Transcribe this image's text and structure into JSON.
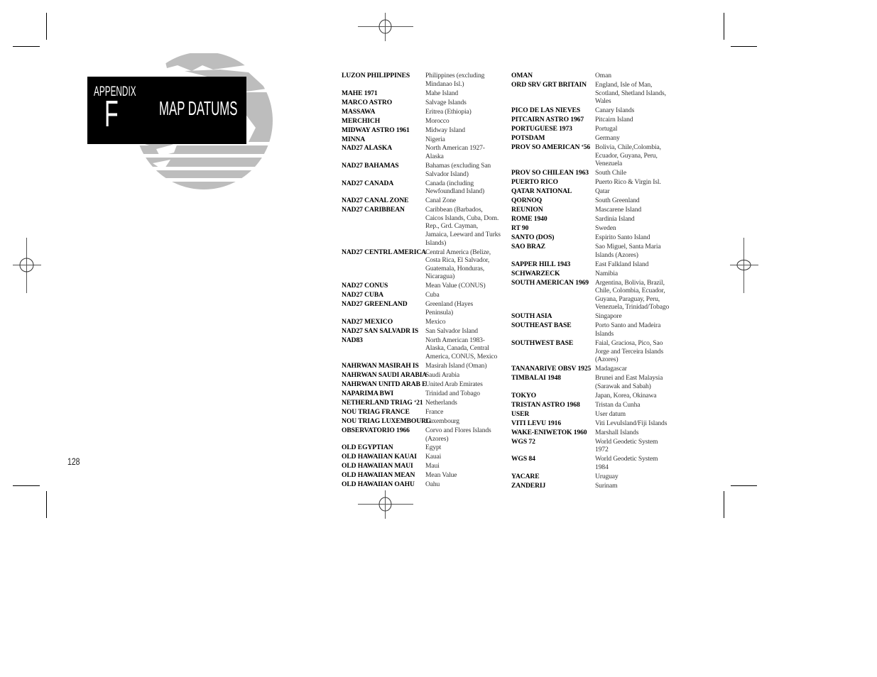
{
  "header": {
    "appendix_label": "APPENDIX",
    "appendix_letter": "F",
    "title": "MAP DATUMS",
    "globe_icon": "globe-icon"
  },
  "page_number": "128",
  "colors": {
    "header_bg": "#000000",
    "header_text": "#ffffff",
    "globe_gray": "#bdbdbd",
    "body_text": "#000000"
  },
  "datums_left": [
    {
      "name": "LUZON PHILIPPINES",
      "region": "Philippines (excluding Mindanao Isl.)"
    },
    {
      "name": "MAHE 1971",
      "region": "Mahe Island"
    },
    {
      "name": "MARCO ASTRO",
      "region": "Salvage Islands"
    },
    {
      "name": "MASSAWA",
      "region": "Eritrea (Ethiopia)"
    },
    {
      "name": "MERCHICH",
      "region": "Morocco"
    },
    {
      "name": "MIDWAY ASTRO 1961",
      "region": "Midway Island"
    },
    {
      "name": "MINNA",
      "region": "Nigeria"
    },
    {
      "name": "NAD27 ALASKA",
      "region": "North American 1927- Alaska"
    },
    {
      "name": "NAD27 BAHAMAS",
      "region": "Bahamas (excluding San Salvador Island)"
    },
    {
      "name": "NAD27 CANADA",
      "region": "Canada (including Newfoundland Island)"
    },
    {
      "name": "NAD27 CANAL ZONE",
      "region": "Canal Zone"
    },
    {
      "name": "NAD27 CARIBBEAN",
      "region": "Caribbean (Barbados, Caicos Islands, Cuba, Dom. Rep., Grd. Cayman, Jamaica, Leeward and Turks Islands)"
    },
    {
      "name": "NAD27 CENTRL AMERICA",
      "region": "Central America (Belize, Costa Rica, El Salvador, Guatemala, Honduras, Nicaragua)"
    },
    {
      "name": "NAD27 CONUS",
      "region": "Mean Value (CONUS)"
    },
    {
      "name": "NAD27 CUBA",
      "region": "Cuba"
    },
    {
      "name": "NAD27 GREENLAND",
      "region": "Greenland (Hayes Peninsula)"
    },
    {
      "name": "NAD27 MEXICO",
      "region": "Mexico"
    },
    {
      "name": "NAD27 SAN SALVADR IS",
      "region": "San Salvador Island"
    },
    {
      "name": "NAD83",
      "region": "North American 1983- Alaska, Canada, Central America, CONUS, Mexico"
    },
    {
      "name": "NAHRWAN MASIRAH IS",
      "region": "Masirah Island (Oman)"
    },
    {
      "name": "NAHRWAN SAUDI ARABIA",
      "region": "Saudi Arabia"
    },
    {
      "name": "NAHRWAN UNITD ARAB E",
      "region": "United Arab Emirates"
    },
    {
      "name": "NAPARIMA BWI",
      "region": "Trinidad and Tobago"
    },
    {
      "name": "NETHERLAND TRIAG ‘21",
      "region": "Netherlands"
    },
    {
      "name": "NOU TRIAG FRANCE",
      "region": "France"
    },
    {
      "name": "NOU TRIAG LUXEMBOURG",
      "region": "Luxembourg"
    },
    {
      "name": "OBSERVATORIO 1966",
      "region": "Corvo and Flores Islands (Azores)"
    },
    {
      "name": "OLD EGYPTIAN",
      "region": "Egypt"
    },
    {
      "name": "OLD HAWAIIAN KAUAI",
      "region": "Kauai"
    },
    {
      "name": "OLD HAWAIIAN MAUI",
      "region": "Maui"
    },
    {
      "name": "OLD HAWAIIAN MEAN",
      "region": "Mean Value"
    },
    {
      "name": "OLD HAWAIIAN OAHU",
      "region": "Oahu"
    }
  ],
  "datums_right": [
    {
      "name": "OMAN",
      "region": "Oman"
    },
    {
      "name": "ORD SRV GRT BRITAIN",
      "region": "England, Isle of Man, Scotland, Shetland Islands, Wales"
    },
    {
      "name": "PICO DE LAS NIEVES",
      "region": "Canary Islands"
    },
    {
      "name": "PITCAIRN ASTRO 1967",
      "region": "Pitcairn Island"
    },
    {
      "name": "PORTUGUESE 1973",
      "region": "Portugal"
    },
    {
      "name": "POTSDAM",
      "region": "Germany"
    },
    {
      "name": "PROV SO AMERICAN ‘56",
      "region": "Bolivia, Chile,Colombia, Ecuador, Guyana, Peru, Venezuela"
    },
    {
      "name": "PROV SO CHILEAN 1963",
      "region": "South Chile"
    },
    {
      "name": "PUERTO RICO",
      "region": "Puerto Rico & Virgin Isl."
    },
    {
      "name": "QATAR NATIONAL",
      "region": "Qatar"
    },
    {
      "name": "QORNOQ",
      "region": "South Greenland"
    },
    {
      "name": "REUNION",
      "region": "Mascarene Island"
    },
    {
      "name": "ROME 1940",
      "region": "Sardinia Island"
    },
    {
      "name": "RT 90",
      "region": "Sweden"
    },
    {
      "name": "SANTO (DOS)",
      "region": "Espirito Santo Island"
    },
    {
      "name": "SAO BRAZ",
      "region": "Sao Miguel, Santa Maria Islands (Azores)"
    },
    {
      "name": "SAPPER HILL 1943",
      "region": "East Falkland Island"
    },
    {
      "name": "SCHWARZECK",
      "region": "Namibia"
    },
    {
      "name": "SOUTH AMERICAN 1969",
      "region": "Argentina, Bolivia, Brazil, Chile, Colombia, Ecuador, Guyana, Paraguay, Peru, Venezuela, Trinidad/Tobago"
    },
    {
      "name": "SOUTH ASIA",
      "region": "Singapore"
    },
    {
      "name": "SOUTHEAST BASE",
      "region": "Porto Santo and Madeira Islands"
    },
    {
      "name": "SOUTHWEST BASE",
      "region": "Faial, Graciosa, Pico, Sao Jorge and Terceira Islands (Azores)"
    },
    {
      "name": "TANANARIVE OBSV 1925",
      "region": "Madagascar"
    },
    {
      "name": "TIMBALAI 1948",
      "region": "Brunei and East Malaysia (Sarawak and Sabah)"
    },
    {
      "name": "TOKYO",
      "region": "Japan, Korea, Okinawa"
    },
    {
      "name": "TRISTAN ASTRO 1968",
      "region": "Tristan da Cunha"
    },
    {
      "name": "USER",
      "region": "User datum"
    },
    {
      "name": "VITI LEVU 1916",
      "region": "Viti LevuIsland/Fiji Islands"
    },
    {
      "name": "WAKE-ENIWETOK 1960",
      "region": "Marshall Islands"
    },
    {
      "name": "WGS 72",
      "region": "World Geodetic System 1972"
    },
    {
      "name": "WGS 84",
      "region": "World Geodetic System 1984"
    },
    {
      "name": "YACARE",
      "region": "Uruguay"
    },
    {
      "name": "ZANDERIJ",
      "region": "Surinam"
    }
  ]
}
